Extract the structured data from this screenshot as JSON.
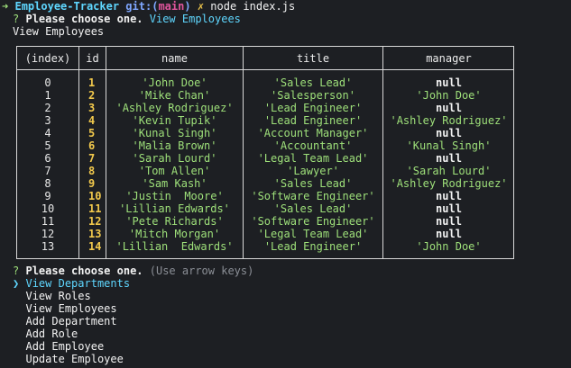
{
  "prompt": {
    "arrow": "➜",
    "dir": "Employee-Tracker",
    "git_label": "git:",
    "git_open": "(",
    "branch": "main",
    "git_close": ")",
    "dirty_mark": "✗",
    "command": "node index.js"
  },
  "first_question": {
    "marker": "?",
    "text": "Please choose one.",
    "answer": "View Employees"
  },
  "echo_line": "View Employees",
  "table": {
    "headers": {
      "index": "(index)",
      "id": "id",
      "name": "name",
      "title": "title",
      "manager": "manager"
    },
    "rows": [
      {
        "index": "0",
        "id": "1",
        "name": "'John Doe'",
        "title": "'Sales Lead'",
        "manager": "null"
      },
      {
        "index": "1",
        "id": "2",
        "name": "'Mike Chan'",
        "title": "'Salesperson'",
        "manager": "'John Doe'"
      },
      {
        "index": "2",
        "id": "3",
        "name": "'Ashley Rodriguez'",
        "title": "'Lead Engineer'",
        "manager": "null"
      },
      {
        "index": "3",
        "id": "4",
        "name": "'Kevin Tupik'",
        "title": "'Lead Engineer'",
        "manager": "'Ashley Rodriguez'"
      },
      {
        "index": "4",
        "id": "5",
        "name": "'Kunal Singh'",
        "title": "'Account Manager'",
        "manager": "null"
      },
      {
        "index": "5",
        "id": "6",
        "name": "'Malia Brown'",
        "title": "'Accountant'",
        "manager": "'Kunal Singh'"
      },
      {
        "index": "6",
        "id": "7",
        "name": "'Sarah Lourd'",
        "title": "'Legal Team Lead'",
        "manager": "null"
      },
      {
        "index": "7",
        "id": "8",
        "name": "'Tom Allen'",
        "title": "'Lawyer'",
        "manager": "'Sarah Lourd'"
      },
      {
        "index": "8",
        "id": "9",
        "name": "'Sam Kash'",
        "title": "'Sales Lead'",
        "manager": "'Ashley Rodriguez'"
      },
      {
        "index": "9",
        "id": "10",
        "name": "'Justin  Moore'",
        "title": "'Software Engineer'",
        "manager": "null"
      },
      {
        "index": "10",
        "id": "11",
        "name": "'Lillian Edwards'",
        "title": "'Sales Lead'",
        "manager": "null"
      },
      {
        "index": "11",
        "id": "12",
        "name": "'Pete Richards'",
        "title": "'Software Engineer'",
        "manager": "null"
      },
      {
        "index": "12",
        "id": "13",
        "name": "'Mitch Morgan'",
        "title": "'Legal Team Lead'",
        "manager": "null"
      },
      {
        "index": "13",
        "id": "14",
        "name": "'Lillian  Edwards'",
        "title": "'Lead Engineer'",
        "manager": "'John Doe'"
      }
    ]
  },
  "second_question": {
    "marker": "?",
    "text": "Please choose one.",
    "hint": "(Use arrow keys)"
  },
  "menu": {
    "pointer": "❯",
    "items": [
      "View Departments",
      "View Roles",
      "View Employees",
      "Add Department",
      "Add Role",
      "Add Employee",
      "Update Employee"
    ],
    "selected_index": 0
  },
  "colors": {
    "background": "#1d1f23",
    "cyan": "#5fd7ff",
    "magenta": "#e0559c",
    "green": "#9ee07a",
    "yellow": "#f2c94c",
    "gray": "#8b8f96"
  }
}
